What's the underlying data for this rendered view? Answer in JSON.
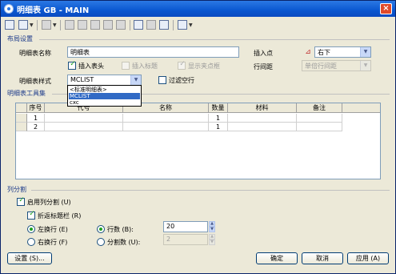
{
  "window": {
    "title": "明细表 GB - MAIN",
    "close_label": "×"
  },
  "toolbar": {
    "items": [
      "table-icon",
      "insert-row-icon",
      "delete-row-icon",
      "move-up-icon",
      "move-down-icon",
      "merge-icon",
      "split-icon",
      "sort-icon",
      "format-icon",
      "edit-icon",
      "view-icon"
    ]
  },
  "layout_section": {
    "title": "布局设置",
    "table_name_label": "明细表名称",
    "table_name_value": "明细表",
    "insert_header_label": "插入表头",
    "insert_header_checked": true,
    "insert_title_label": "插入标题",
    "insert_title_checked": false,
    "show_grip_label": "显示夹点框",
    "show_grip_checked": true,
    "insert_point_label": "插入点",
    "insert_point_value": "右下",
    "row_spacing_label": "行间距",
    "row_spacing_value": "单倍行间距",
    "style_label": "明细表样式",
    "style_value": "MCLIST",
    "style_options": [
      "<标准明细表>",
      "MCLIST",
      "cxc"
    ],
    "style_selected_index": 1,
    "filter_empty_label": "过滤空行",
    "filter_empty_checked": false
  },
  "tool_section": {
    "title": "明细表工具集"
  },
  "table": {
    "columns": [
      "序号",
      "代号",
      "名称",
      "数量",
      "材料",
      "备注"
    ],
    "rows": [
      [
        "1",
        "",
        "",
        "1",
        "",
        ""
      ],
      [
        "2",
        "",
        "",
        "1",
        "",
        ""
      ]
    ]
  },
  "column_split": {
    "title": "列分割",
    "enable_label": "启用列分割 (U)",
    "enable_checked": true,
    "fold_title_label": "折返标题栏 (R)",
    "fold_title_checked": true,
    "left_wrap_label": "左换行 (E)",
    "right_wrap_label": "右换行 (F)",
    "wrap_selected": "left",
    "rows_label": "行数 (B):",
    "rows_value": "20",
    "split_label": "分割数 (U):",
    "split_value": "2",
    "count_mode": "rows"
  },
  "buttons": {
    "settings": "设置 (S)...",
    "ok": "确定",
    "cancel": "取消",
    "apply": "应用 (A)"
  }
}
